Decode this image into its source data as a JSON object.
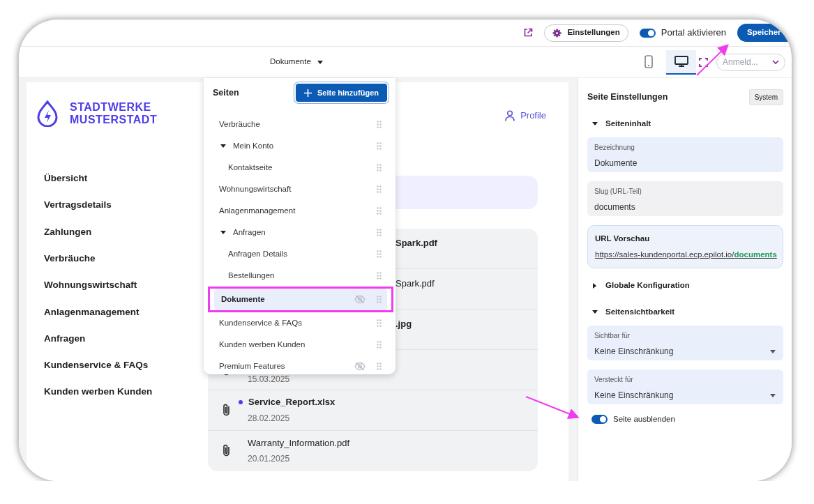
{
  "toolbar": {
    "settings_button": "Einstellungen",
    "portal_toggle": {
      "label": "Portal aktivieren",
      "on": true
    },
    "save_button": "Speicher"
  },
  "preview_bar": {
    "page_select": "Dokumente",
    "devices": [
      {
        "kind": "mobile",
        "selected": false
      },
      {
        "kind": "desktop",
        "selected": true
      }
    ],
    "audience_select": {
      "placeholder": "Anmeld..."
    }
  },
  "preview": {
    "logo": [
      "STADTWERKE",
      "MUSTERSTADT"
    ],
    "nav": [
      "Übersicht",
      "Vertragsdetails",
      "Zahlungen",
      "Verbräuche",
      "Wohnungswirtschaft",
      "Anlagenmanagement",
      "Anfragen",
      "Kundenservice & FAQs",
      "Kunden werben Kunden"
    ],
    "profile_link": "Profile",
    "files": [
      {
        "kind": "clipped",
        "name": "Spark.pdf",
        "unread": true
      },
      {
        "kind": "clipped",
        "name": "Spark.pdf",
        "unread": false
      },
      {
        "kind": "clipped",
        "name": ".jpg",
        "unread": true
      },
      {
        "kind": "date_only",
        "date": "15.03.2025"
      },
      {
        "kind": "full",
        "name": "Service_Report.xlsx",
        "date": "28.02.2025",
        "unread": true
      },
      {
        "kind": "full",
        "name": "Warranty_Information.pdf",
        "date": "20.01.2025",
        "unread": false
      }
    ]
  },
  "pages_menu": {
    "title": "Seiten",
    "add_button": "Seite hinzufügen",
    "items": [
      {
        "label": "Verbräuche",
        "selected": false,
        "hidden": false,
        "annotated": false
      },
      {
        "label": "Mein Konto",
        "selected": false,
        "hidden": false,
        "annotated": false,
        "expanded": true,
        "children": [
          {
            "label": "Kontaktseite",
            "selected": false,
            "hidden": false,
            "annotated": false
          }
        ]
      },
      {
        "label": "Wohnungswirtschaft",
        "selected": false,
        "hidden": false,
        "annotated": false
      },
      {
        "label": "Anlagenmanagement",
        "selected": false,
        "hidden": false,
        "annotated": false
      },
      {
        "label": "Anfragen",
        "selected": false,
        "hidden": false,
        "annotated": false,
        "expanded": true,
        "children": [
          {
            "label": "Anfragen Details",
            "selected": false,
            "hidden": false,
            "annotated": false
          },
          {
            "label": "Bestellungen",
            "selected": false,
            "hidden": false,
            "annotated": false
          }
        ]
      },
      {
        "label": "Dokumente",
        "selected": true,
        "hidden": true,
        "annotated": true
      },
      {
        "label": "Kundenservice & FAQs",
        "selected": false,
        "hidden": false,
        "annotated": false
      },
      {
        "label": "Kunden werben Kunden",
        "selected": false,
        "hidden": false,
        "annotated": false
      },
      {
        "label": "Premium Features",
        "selected": false,
        "hidden": true,
        "annotated": false
      }
    ]
  },
  "settings": {
    "title": "Seite Einstellungen",
    "badge": "System",
    "sections": [
      {
        "title": "Seiteninhalt",
        "expanded": true,
        "fields": [
          {
            "kind": "text",
            "label": "Bezeichnung",
            "value": "Dokumente",
            "editable": true
          },
          {
            "kind": "text",
            "label": "Slug (URL-Teil)",
            "value": "documents",
            "editable": false
          },
          {
            "kind": "url_preview",
            "label": "URL Vorschau",
            "url_base": "https://sales-kundenportal.ecp.epilot.io/",
            "url_slug": "documents"
          }
        ]
      },
      {
        "title": "Globale Konfiguration",
        "expanded": false
      },
      {
        "title": "Seitensichtbarkeit",
        "expanded": true,
        "fields": [
          {
            "kind": "select",
            "label": "Sichtbar für",
            "value": "Keine Einschränkung",
            "editable": true
          },
          {
            "kind": "select",
            "label": "Versteckt für",
            "value": "Keine Einschränkung",
            "editable": true
          },
          {
            "kind": "toggle",
            "label": "Seite ausblenden",
            "on": true
          }
        ]
      }
    ]
  }
}
